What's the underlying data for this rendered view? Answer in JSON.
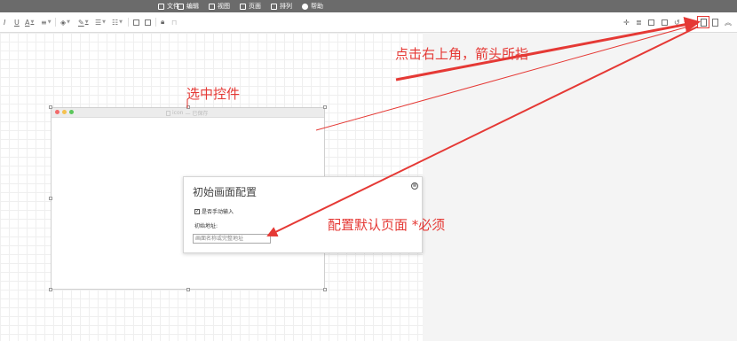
{
  "menubar": {
    "items": [
      {
        "label": "文件",
        "icon": "file-icon"
      },
      {
        "label": "编辑",
        "icon": "edit-icon"
      },
      {
        "label": "视图",
        "icon": "view-icon"
      },
      {
        "label": "页面",
        "icon": "page-icon"
      },
      {
        "label": "排列",
        "icon": "arrange-icon"
      },
      {
        "label": "帮助",
        "icon": "help-icon"
      }
    ]
  },
  "toolbar": {
    "italic": "I",
    "underline": "U",
    "font_color": "A"
  },
  "window": {
    "title": "icon",
    "subtitle": "— 已保存"
  },
  "popup": {
    "title": "初始画面配置",
    "close_glyph": "⊗",
    "checkbox_label": "是否手动输入",
    "address_label": "初始地址:",
    "address_placeholder": "画面名称或完整地址"
  },
  "annotations": {
    "select_control": "选中控件",
    "click_top_right": "点击右上角，箭头所指",
    "config_default_page": "配置默认页面 *必须",
    "color": "#e53935"
  }
}
